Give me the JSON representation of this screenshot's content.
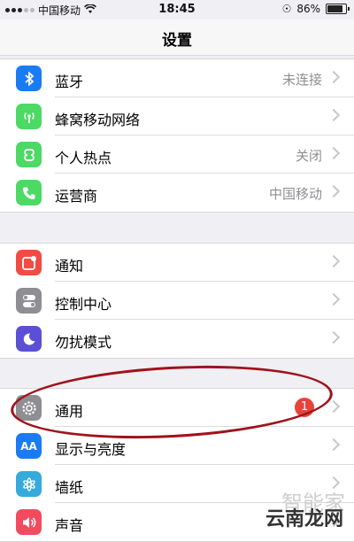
{
  "status_bar": {
    "carrier": "中国移动",
    "time": "18:45",
    "battery": "86%",
    "battery_level": 0.86
  },
  "nav": {
    "title": "设置"
  },
  "groups": [
    {
      "rows": [
        {
          "label": "蓝牙",
          "value": "未连接",
          "icon": "bluetooth-icon",
          "color": "#1a7cf5"
        },
        {
          "label": "蜂窝移动网络",
          "value": "",
          "icon": "cellular-icon",
          "color": "#4cd964"
        },
        {
          "label": "个人热点",
          "value": "关闭",
          "icon": "hotspot-icon",
          "color": "#4cd964"
        },
        {
          "label": "运营商",
          "value": "中国移动",
          "icon": "phone-icon",
          "color": "#4cd964"
        }
      ]
    },
    {
      "rows": [
        {
          "label": "通知",
          "value": "",
          "icon": "notification-icon",
          "color": "#f24b43"
        },
        {
          "label": "控制中心",
          "value": "",
          "icon": "control-center-icon",
          "color": "#8e8e93"
        },
        {
          "label": "勿扰模式",
          "value": "",
          "icon": "moon-icon",
          "color": "#5b4fd6"
        }
      ]
    },
    {
      "rows": [
        {
          "label": "通用",
          "value": "",
          "badge": "1",
          "icon": "gear-icon",
          "color": "#8e8e93"
        },
        {
          "label": "显示与亮度",
          "value": "",
          "icon": "display-icon",
          "color": "#1a7cf5"
        },
        {
          "label": "墙纸",
          "value": "",
          "icon": "wallpaper-icon",
          "color": "#36aadc"
        },
        {
          "label": "声音",
          "value": "",
          "icon": "sound-icon",
          "color": "#f24b5f"
        }
      ]
    }
  ],
  "watermark": {
    "faint": "智能家",
    "text": "云南龙网"
  }
}
